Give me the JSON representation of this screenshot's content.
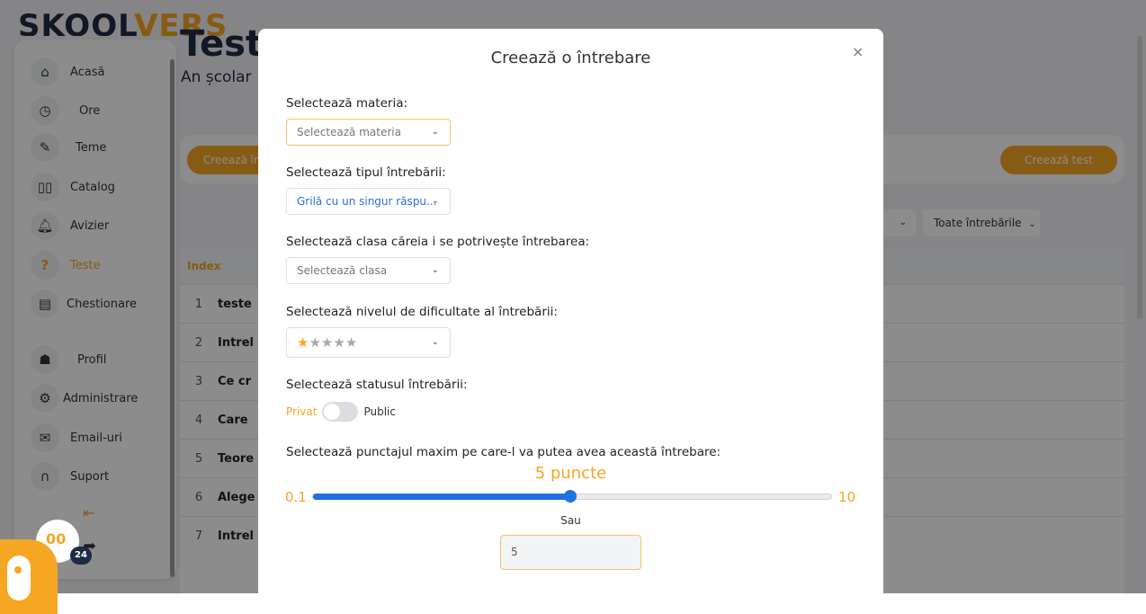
{
  "app": {
    "logo_main": "SKOOL",
    "logo_accent": "VERS",
    "page_title": "Teste",
    "page_subtitle": "An școlar",
    "btn_create_question": "Creează întrebare",
    "btn_create_test": "Creează test",
    "filter_all_questions": "Toate întrebările",
    "table_header_index": "Index",
    "rows": [
      {
        "index": "1",
        "text": "teste"
      },
      {
        "index": "2",
        "text": "Intrel"
      },
      {
        "index": "3",
        "text": "Ce cr"
      },
      {
        "index": "4",
        "text": "Care"
      },
      {
        "index": "5",
        "text": "Teore"
      },
      {
        "index": "6",
        "text": "Alege"
      },
      {
        "index": "7",
        "text": "Intrel"
      }
    ]
  },
  "sidebar": {
    "items": [
      {
        "label": "Acasă",
        "icon": "home-icon"
      },
      {
        "label": "Ore",
        "icon": "clock-icon"
      },
      {
        "label": "Teme",
        "icon": "pencil-icon"
      },
      {
        "label": "Catalog",
        "icon": "book-icon"
      },
      {
        "label": "Avizier",
        "icon": "bell-icon"
      },
      {
        "label": "Teste",
        "icon": "question-icon"
      },
      {
        "label": "Chestionare",
        "icon": "document-icon"
      },
      {
        "label": "Profil",
        "icon": "profile-icon"
      },
      {
        "label": "Administrare",
        "icon": "gears-icon"
      },
      {
        "label": "Email-uri",
        "icon": "mail-icon"
      },
      {
        "label": "Suport",
        "icon": "headset-icon"
      }
    ],
    "notification_count": "24",
    "helper_text": "00"
  },
  "modal": {
    "title": "Creează o întrebare",
    "close": "×",
    "subject_label": "Selectează materia:",
    "subject_placeholder": "Selectează materia",
    "type_label": "Selectează tipul întrebării:",
    "type_value": "Grilă cu un singur răspu...",
    "class_label": "Selectează clasa căreia i se potrivește întrebarea:",
    "class_placeholder": "Selectează clasa",
    "difficulty_label": "Selectează nivelul de dificultate al întrebării:",
    "difficulty_rating": 1,
    "difficulty_max": 5,
    "status_label": "Selectează statusul întrebării:",
    "status_private": "Privat",
    "status_public": "Public",
    "points_label": "Selectează punctajul maxim pe care-l va putea avea această întrebare:",
    "points_text": "5 puncte",
    "slider_min": "0.1",
    "slider_max": "10",
    "slider_value": 5,
    "or_text": "Sau",
    "points_input_value": "5"
  },
  "colors": {
    "accent": "#f5a623",
    "slider": "#1f6fe5",
    "navy": "#1f2a44"
  }
}
